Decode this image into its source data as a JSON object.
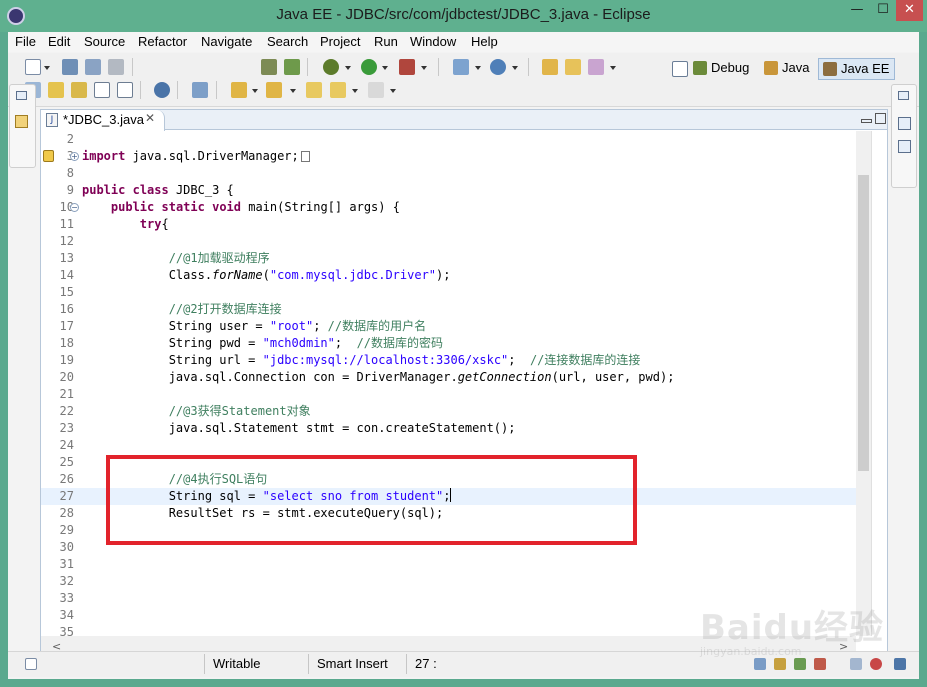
{
  "window": {
    "title": "Java EE - JDBC/src/com/jdbctest/JDBC_3.java - Eclipse",
    "min_glyph": "—",
    "max_glyph": "☐",
    "close_glyph": "✕"
  },
  "menu": [
    "File",
    "Edit",
    "Source",
    "Refactor",
    "Navigate",
    "Search",
    "Project",
    "Run",
    "Window",
    "Help"
  ],
  "perspectives": {
    "debug": "Debug",
    "java": "Java",
    "javaee": "Java EE"
  },
  "editor": {
    "tab_label": "*JDBC_3.java",
    "tab_icon_glyph": "J",
    "tab_close_glyph": "✕",
    "lines": [
      {
        "num": "2"
      },
      {
        "num": "3",
        "fold": "+",
        "marker": true,
        "segs": [
          {
            "t": "import",
            "s": "kw"
          },
          {
            "t": " java.sql.DriverManager;"
          }
        ],
        "folded": true
      },
      {
        "num": "8"
      },
      {
        "num": "9",
        "segs": [
          {
            "t": "public",
            "s": "kw"
          },
          {
            "t": " "
          },
          {
            "t": "class",
            "s": "kw"
          },
          {
            "t": " JDBC_3 {"
          }
        ]
      },
      {
        "num": "10",
        "fold": "−",
        "segs": [
          {
            "t": "    "
          },
          {
            "t": "public",
            "s": "kw"
          },
          {
            "t": " "
          },
          {
            "t": "static",
            "s": "kw"
          },
          {
            "t": " "
          },
          {
            "t": "void",
            "s": "kw"
          },
          {
            "t": " main(String[] args) {"
          }
        ]
      },
      {
        "num": "11",
        "segs": [
          {
            "t": "        "
          },
          {
            "t": "try",
            "s": "kw"
          },
          {
            "t": "{"
          }
        ]
      },
      {
        "num": "12"
      },
      {
        "num": "13",
        "segs": [
          {
            "t": "            "
          },
          {
            "t": "//@1加载驱动程序",
            "s": "cm"
          }
        ]
      },
      {
        "num": "14",
        "segs": [
          {
            "t": "            Class."
          },
          {
            "t": "forName",
            "s": "it"
          },
          {
            "t": "("
          },
          {
            "t": "\"com.mysql.jdbc.Driver\"",
            "s": "str"
          },
          {
            "t": ");"
          }
        ]
      },
      {
        "num": "15"
      },
      {
        "num": "16",
        "segs": [
          {
            "t": "            "
          },
          {
            "t": "//@2打开数据库连接",
            "s": "cm"
          }
        ]
      },
      {
        "num": "17",
        "segs": [
          {
            "t": "            String user = "
          },
          {
            "t": "\"root\"",
            "s": "str"
          },
          {
            "t": "; "
          },
          {
            "t": "//数据库的用户名",
            "s": "cm"
          }
        ]
      },
      {
        "num": "18",
        "segs": [
          {
            "t": "            String pwd = "
          },
          {
            "t": "\"mch0dmin\"",
            "s": "str"
          },
          {
            "t": ";  "
          },
          {
            "t": "//数据库的密码",
            "s": "cm"
          }
        ]
      },
      {
        "num": "19",
        "segs": [
          {
            "t": "            String url = "
          },
          {
            "t": "\"jdbc:mysql://localhost:3306/xskc\"",
            "s": "str"
          },
          {
            "t": ";  "
          },
          {
            "t": "//连接数据库的连接",
            "s": "cm"
          }
        ]
      },
      {
        "num": "20",
        "segs": [
          {
            "t": "            java.sql.Connection con = DriverManager."
          },
          {
            "t": "getConnection",
            "s": "it"
          },
          {
            "t": "(url, user, pwd);"
          }
        ]
      },
      {
        "num": "21"
      },
      {
        "num": "22",
        "segs": [
          {
            "t": "            "
          },
          {
            "t": "//@3获得Statement对象",
            "s": "cm"
          }
        ]
      },
      {
        "num": "23",
        "segs": [
          {
            "t": "            java.sql.Statement stmt = con.createStatement();"
          }
        ]
      },
      {
        "num": "24"
      },
      {
        "num": "25"
      },
      {
        "num": "26",
        "segs": [
          {
            "t": "            "
          },
          {
            "t": "//@4执行SQL语句",
            "s": "cm"
          }
        ]
      },
      {
        "num": "27",
        "current": true,
        "caret": true,
        "segs": [
          {
            "t": "            String sql = "
          },
          {
            "t": "\"select sno from student\"",
            "s": "str"
          },
          {
            "t": ";"
          }
        ]
      },
      {
        "num": "28",
        "segs": [
          {
            "t": "            ResultSet rs = stmt.executeQuery(sql);"
          }
        ]
      },
      {
        "num": "29"
      },
      {
        "num": "30"
      },
      {
        "num": "31"
      },
      {
        "num": "32"
      },
      {
        "num": "33"
      },
      {
        "num": "34"
      },
      {
        "num": "35"
      }
    ]
  },
  "status": {
    "writable": "Writable",
    "insert_mode": "Smart Insert",
    "position": "27 :"
  },
  "watermark": {
    "brand": "Baidu经验",
    "url": "jingyan.baidu.com"
  },
  "colors": {
    "frame": "#5fb08f",
    "keyword": "#7f0055",
    "comment": "#3f7f5f",
    "string": "#2a00ff",
    "highlight_box": "#e2232b",
    "current_line": "#e8f2fe"
  }
}
